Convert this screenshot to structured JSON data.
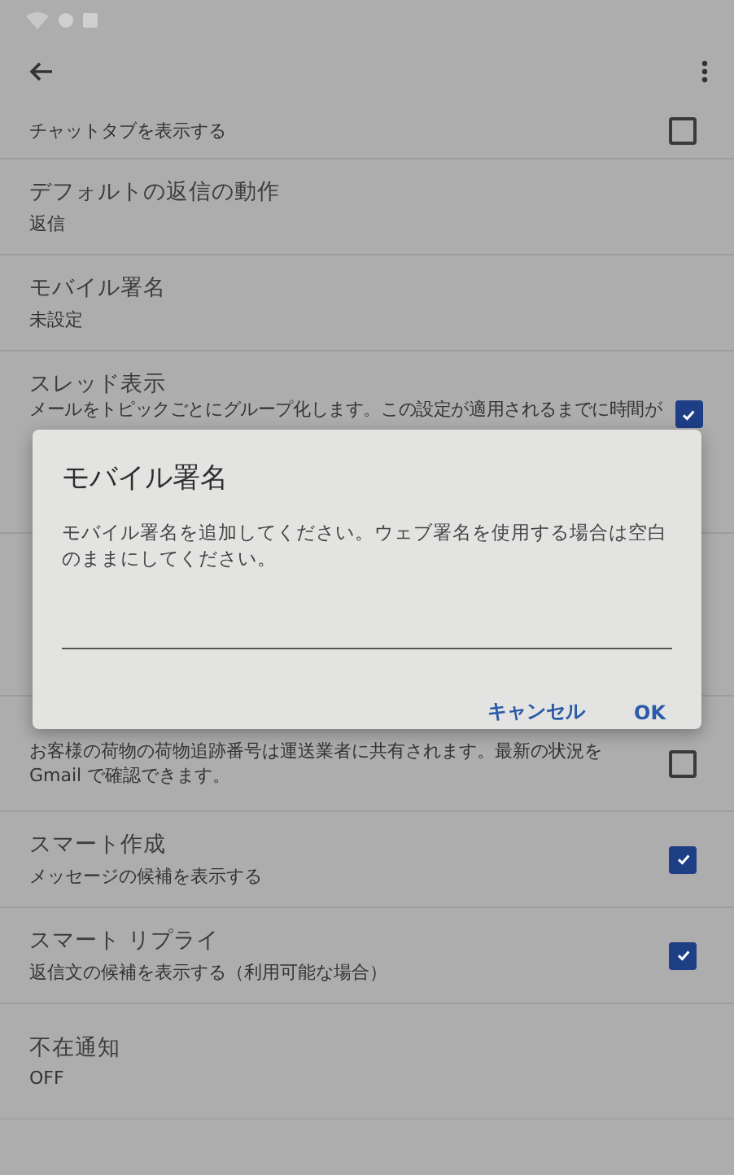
{
  "settings": [
    {
      "kind": "toggle",
      "subtitle": "チャットタブを表示する",
      "checked": false
    },
    {
      "kind": "value",
      "title": "デフォルトの返信の動作",
      "subtitle": "返信"
    },
    {
      "kind": "value",
      "title": "モバイル署名",
      "subtitle": "未設定"
    },
    {
      "kind": "toggle",
      "title": "スレッド表示",
      "subtitle": "メールをトピックごとにグループ化します。この設定が適用されるまでに時間が",
      "checked": true
    },
    {
      "kind": "hidden"
    },
    {
      "kind": "toggle",
      "subtitle": "お客様の荷物の荷物追跡番号は運送業者に共有されます。最新の状況を Gmail で確認できます。",
      "checked": false
    },
    {
      "kind": "toggle",
      "title": "スマート作成",
      "subtitle": "メッセージの候補を表示する",
      "checked": true
    },
    {
      "kind": "toggle",
      "title": "スマート リプライ",
      "subtitle": "返信文の候補を表示する（利用可能な場合）",
      "checked": true
    },
    {
      "kind": "value",
      "title": "不在通知",
      "subtitle": "OFF"
    }
  ],
  "dialog": {
    "title": "モバイル署名",
    "message": "モバイル署名を追加してください。ウェブ署名を使用する場合は空白のままにしてください。",
    "buttons": [
      "キャンセル",
      "OK"
    ]
  }
}
